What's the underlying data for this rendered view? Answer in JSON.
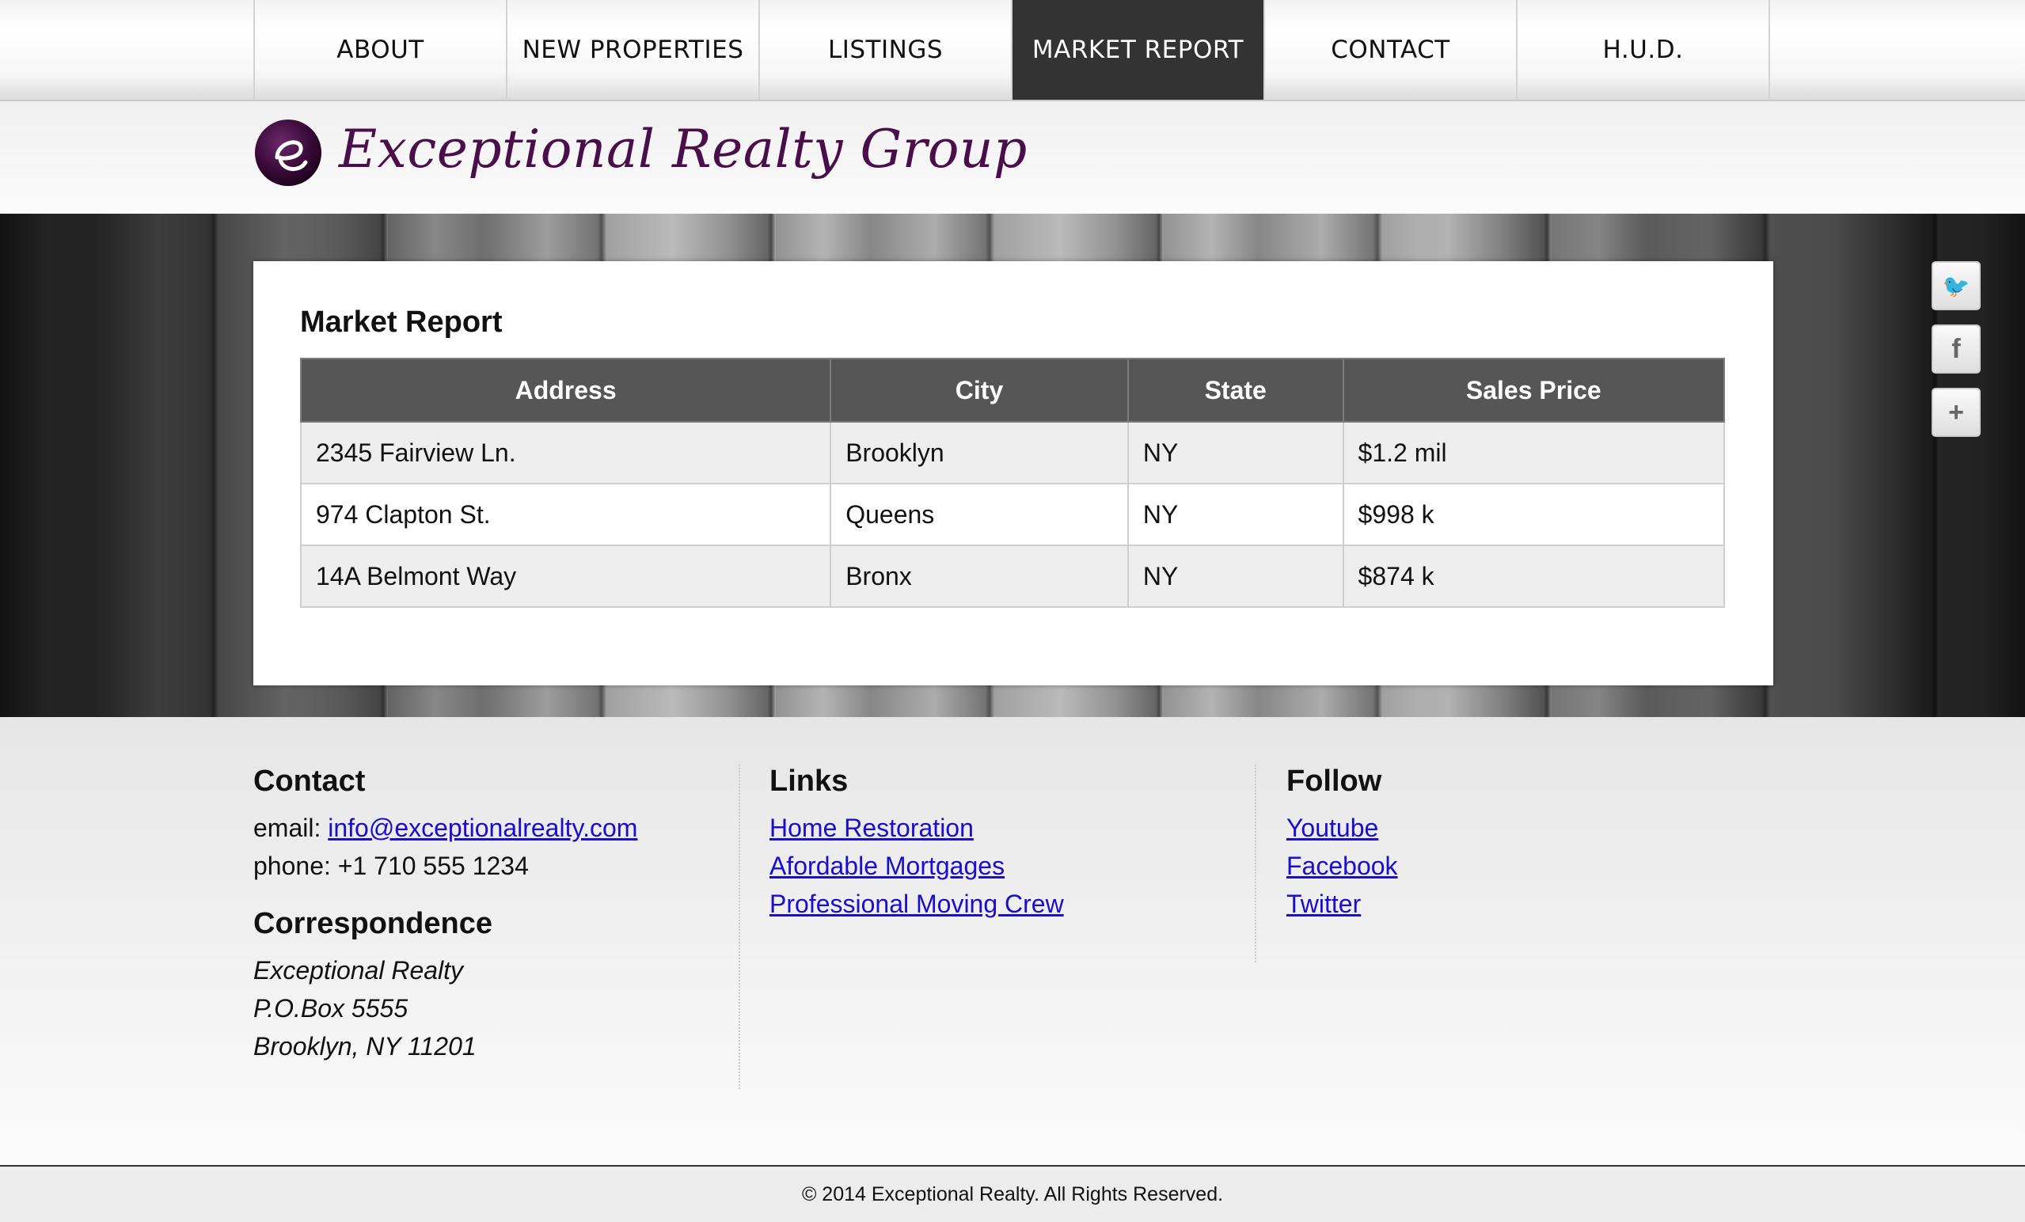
{
  "nav": {
    "items": [
      {
        "label": "ABOUT"
      },
      {
        "label": "NEW PROPERTIES"
      },
      {
        "label": "LISTINGS"
      },
      {
        "label": "MARKET REPORT"
      },
      {
        "label": "CONTACT"
      },
      {
        "label": "H.U.D."
      }
    ],
    "active_index": 3
  },
  "brand": {
    "name": "Exceptional Realty Group",
    "logo_letter": "e",
    "logo_color": "#3a0a3a"
  },
  "social": [
    {
      "icon": "twitter-icon",
      "glyph": "🐦"
    },
    {
      "icon": "facebook-icon",
      "glyph": "f"
    },
    {
      "icon": "plus-icon",
      "glyph": "+"
    }
  ],
  "report": {
    "title": "Market Report",
    "columns": [
      "Address",
      "City",
      "State",
      "Sales Price"
    ],
    "rows": [
      [
        "2345 Fairview Ln.",
        "Brooklyn",
        "NY",
        "$1.2 mil"
      ],
      [
        "974 Clapton St.",
        "Queens",
        "NY",
        "$998 k"
      ],
      [
        "14A Belmont Way",
        "Bronx",
        "NY",
        "$874 k"
      ]
    ]
  },
  "footer": {
    "contact": {
      "heading": "Contact",
      "email_label": "email: ",
      "email": "info@exceptionalrealty.com",
      "phone": "phone: +1 710 555 1234"
    },
    "correspondence": {
      "heading": "Correspondence",
      "lines": [
        "Exceptional Realty",
        "P.O.Box 5555",
        "Brooklyn, NY 11201"
      ]
    },
    "links": {
      "heading": "Links",
      "items": [
        "Home Restoration",
        "Afordable Mortgages",
        "Professional Moving Crew"
      ]
    },
    "follow": {
      "heading": "Follow",
      "items": [
        "Youtube",
        "Facebook",
        "Twitter"
      ]
    },
    "copyright": "© 2014 Exceptional Realty. All Rights Reserved."
  },
  "colors": {
    "nav_active_bg": "#333333",
    "table_header_bg": "#565656",
    "link": "#1a0dcc",
    "brand_purple": "#4a0f4a"
  }
}
